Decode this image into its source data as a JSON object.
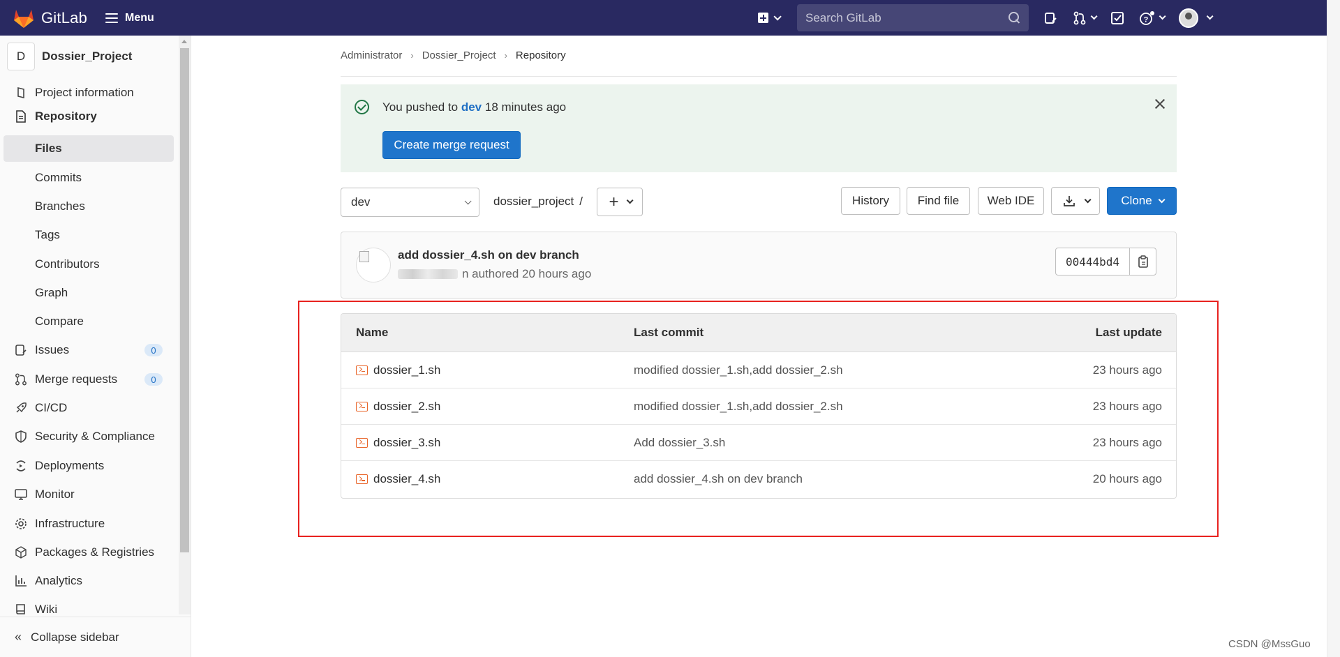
{
  "app": {
    "brand": "GitLab",
    "menu_label": "Menu",
    "search_placeholder": "Search GitLab"
  },
  "sidebar": {
    "project_initial": "D",
    "project_name": "Dossier_Project",
    "items": [
      {
        "label": "Project information",
        "icon": "info-icon"
      },
      {
        "label": "Repository",
        "icon": "document-icon"
      },
      {
        "label": "Files"
      },
      {
        "label": "Commits"
      },
      {
        "label": "Branches"
      },
      {
        "label": "Tags"
      },
      {
        "label": "Contributors"
      },
      {
        "label": "Graph"
      },
      {
        "label": "Compare"
      },
      {
        "label": "Issues",
        "icon": "issues-icon",
        "badge": "0"
      },
      {
        "label": "Merge requests",
        "icon": "merge-request-icon",
        "badge": "0"
      },
      {
        "label": "CI/CD",
        "icon": "rocket-icon"
      },
      {
        "label": "Security & Compliance",
        "icon": "shield-icon"
      },
      {
        "label": "Deployments",
        "icon": "deployments-icon"
      },
      {
        "label": "Monitor",
        "icon": "monitor-icon"
      },
      {
        "label": "Infrastructure",
        "icon": "cloud-gear-icon"
      },
      {
        "label": "Packages & Registries",
        "icon": "package-icon"
      },
      {
        "label": "Analytics",
        "icon": "chart-icon"
      },
      {
        "label": "Wiki",
        "icon": "book-icon"
      }
    ],
    "collapse_label": "Collapse sidebar"
  },
  "breadcrumb": {
    "items": [
      "Administrator",
      "Dossier_Project",
      "Repository"
    ]
  },
  "alert": {
    "prefix": "You pushed to",
    "branch": "dev",
    "suffix": "18 minutes ago",
    "button": "Create merge request"
  },
  "toolbar": {
    "branch": "dev",
    "path": "dossier_project",
    "path_sep": "/",
    "history": "History",
    "find_file": "Find file",
    "web_ide": "Web IDE",
    "clone": "Clone"
  },
  "last_commit": {
    "title": "add dossier_4.sh on dev branch",
    "author_suffix": "n authored",
    "time": "20 hours ago",
    "sha": "00444bd4"
  },
  "file_table": {
    "headers": {
      "name": "Name",
      "last_commit": "Last commit",
      "last_update": "Last update"
    },
    "rows": [
      {
        "name": "dossier_1.sh",
        "commit": "modified dossier_1.sh,add dossier_2.sh",
        "updated": "23 hours ago"
      },
      {
        "name": "dossier_2.sh",
        "commit": "modified dossier_1.sh,add dossier_2.sh",
        "updated": "23 hours ago"
      },
      {
        "name": "dossier_3.sh",
        "commit": "Add dossier_3.sh",
        "updated": "23 hours ago"
      },
      {
        "name": "dossier_4.sh",
        "commit": "add dossier_4.sh on dev branch",
        "updated": "20 hours ago"
      }
    ]
  },
  "watermark": "CSDN @MssGuo",
  "colors": {
    "navbar": "#292961",
    "primary": "#1f75cb",
    "highlight_border": "#e8221f",
    "success": "#217645"
  }
}
